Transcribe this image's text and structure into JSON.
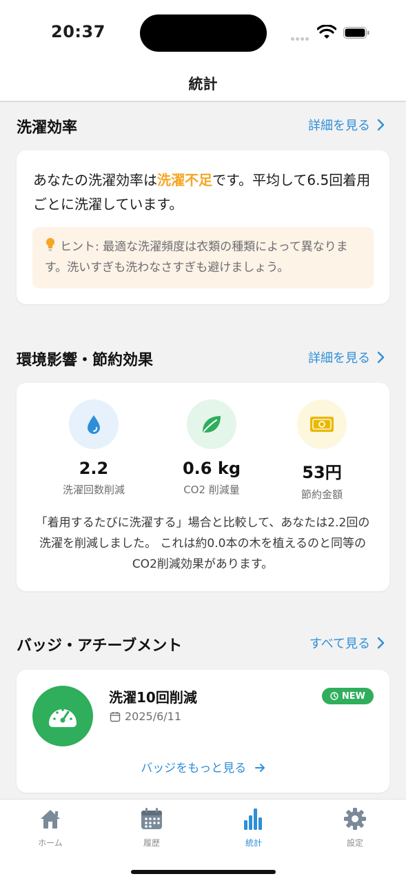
{
  "status_bar": {
    "time": "20:37"
  },
  "nav": {
    "title": "統計"
  },
  "efficiency": {
    "title": "洗濯効率",
    "link": "詳細を見る",
    "text_before": "あなたの洗濯効率は",
    "status": "洗濯不足",
    "text_after": "です。平均して6.5回着用ごとに洗濯しています。",
    "hint": "ヒント: 最適な洗濯頻度は衣類の種類によって異なります。洗いすぎも洗わなさすぎも避けましょう。"
  },
  "environment": {
    "title": "環境影響・節約効果",
    "link": "詳細を見る",
    "stats": [
      {
        "icon": "water-drop-icon",
        "value": "2.2",
        "label": "洗濯回数削減",
        "color": "#2e8fd8",
        "bg": "#e6f1fb"
      },
      {
        "icon": "leaf-icon",
        "value": "0.6 kg",
        "label": "CO2 削減量",
        "color": "#2fae5c",
        "bg": "#e4f5ea"
      },
      {
        "icon": "money-icon",
        "value": "53円",
        "label": "節約金額",
        "color": "#e9b800",
        "bg": "#fdf7dd"
      }
    ],
    "description": "「着用するたびに洗濯する」場合と比較して、あなたは2.2回の洗濯を削減しました。 これは約0.0本の木を植えるのと同等のCO2削減効果があります。"
  },
  "badges": {
    "title": "バッジ・アチーブメント",
    "link": "すべて見る",
    "item": {
      "title": "洗濯10回削減",
      "date": "2025/6/11",
      "tag": "NEW"
    },
    "more": "バッジをもっと見る"
  },
  "tabs": [
    {
      "label": "ホーム",
      "icon": "home-icon",
      "active": false
    },
    {
      "label": "履歴",
      "icon": "calendar-icon",
      "active": false
    },
    {
      "label": "統計",
      "icon": "bar-chart-icon",
      "active": true
    },
    {
      "label": "設定",
      "icon": "gear-icon",
      "active": false
    }
  ],
  "colors": {
    "accent": "#2e8fd8",
    "warning": "#f5a623",
    "success": "#2fae5c"
  }
}
